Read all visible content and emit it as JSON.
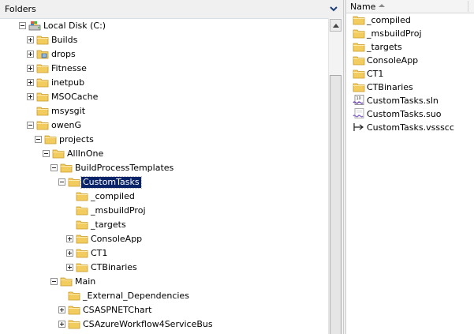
{
  "colors": {
    "folder": "#f2cc5f",
    "selection": "#0a246a",
    "accent": "#3060b0"
  },
  "left": {
    "title": "Folders"
  },
  "tree": [
    {
      "label": "Local Disk (C:)",
      "icon": "drive-icon",
      "expander": "minus",
      "level": 0,
      "selected": false
    },
    {
      "label": "Builds",
      "icon": "folder-icon",
      "expander": "plus",
      "level": 1,
      "selected": false
    },
    {
      "label": "drops",
      "icon": "shared-folder-icon",
      "expander": "plus",
      "level": 1,
      "selected": false
    },
    {
      "label": "Fitnesse",
      "icon": "folder-icon",
      "expander": "plus",
      "level": 1,
      "selected": false
    },
    {
      "label": "inetpub",
      "icon": "folder-icon",
      "expander": "plus",
      "level": 1,
      "selected": false
    },
    {
      "label": "MSOCache",
      "icon": "folder-icon",
      "expander": "plus",
      "level": 1,
      "selected": false
    },
    {
      "label": "msysgit",
      "icon": "folder-icon",
      "expander": "none",
      "level": 1,
      "selected": false
    },
    {
      "label": "owenG",
      "icon": "folder-icon",
      "expander": "minus",
      "level": 1,
      "selected": false
    },
    {
      "label": "projects",
      "icon": "folder-icon",
      "expander": "minus",
      "level": 2,
      "selected": false
    },
    {
      "label": "AllInOne",
      "icon": "folder-icon",
      "expander": "minus",
      "level": 3,
      "selected": false
    },
    {
      "label": "BuildProcessTemplates",
      "icon": "folder-icon",
      "expander": "minus",
      "level": 4,
      "selected": false
    },
    {
      "label": "CustomTasks",
      "icon": "open-folder-icon",
      "expander": "minus",
      "level": 5,
      "selected": true
    },
    {
      "label": "_compiled",
      "icon": "folder-icon",
      "expander": "none",
      "level": 6,
      "selected": false
    },
    {
      "label": "_msbuildProj",
      "icon": "folder-icon",
      "expander": "none",
      "level": 6,
      "selected": false
    },
    {
      "label": "_targets",
      "icon": "folder-icon",
      "expander": "none",
      "level": 6,
      "selected": false
    },
    {
      "label": "ConsoleApp",
      "icon": "folder-icon",
      "expander": "plus",
      "level": 6,
      "selected": false
    },
    {
      "label": "CT1",
      "icon": "folder-icon",
      "expander": "plus",
      "level": 6,
      "selected": false
    },
    {
      "label": "CTBinaries",
      "icon": "folder-icon",
      "expander": "plus",
      "level": 6,
      "selected": false
    },
    {
      "label": "Main",
      "icon": "folder-icon",
      "expander": "minus",
      "level": 4,
      "selected": false
    },
    {
      "label": "_External_Dependencies",
      "icon": "folder-icon",
      "expander": "none",
      "level": 5,
      "selected": false
    },
    {
      "label": "CSASPNETChart",
      "icon": "folder-icon",
      "expander": "plus",
      "level": 5,
      "selected": false
    },
    {
      "label": "CSAzureWorkflow4ServiceBus",
      "icon": "folder-icon",
      "expander": "plus",
      "level": 5,
      "selected": false
    },
    {
      "label": "",
      "icon": "folder-icon",
      "expander": "plus",
      "level": 5,
      "selected": false
    }
  ],
  "right": {
    "column": "Name",
    "files": [
      {
        "label": "_compiled",
        "icon": "folder-icon"
      },
      {
        "label": "_msbuildProj",
        "icon": "folder-icon"
      },
      {
        "label": "_targets",
        "icon": "folder-icon"
      },
      {
        "label": "ConsoleApp",
        "icon": "folder-icon"
      },
      {
        "label": "CT1",
        "icon": "folder-icon"
      },
      {
        "label": "CTBinaries",
        "icon": "folder-icon"
      },
      {
        "label": "CustomTasks.sln",
        "icon": "solution-file-icon"
      },
      {
        "label": "CustomTasks.suo",
        "icon": "suo-file-icon"
      },
      {
        "label": "CustomTasks.vssscc",
        "icon": "vssscc-file-icon"
      }
    ]
  }
}
